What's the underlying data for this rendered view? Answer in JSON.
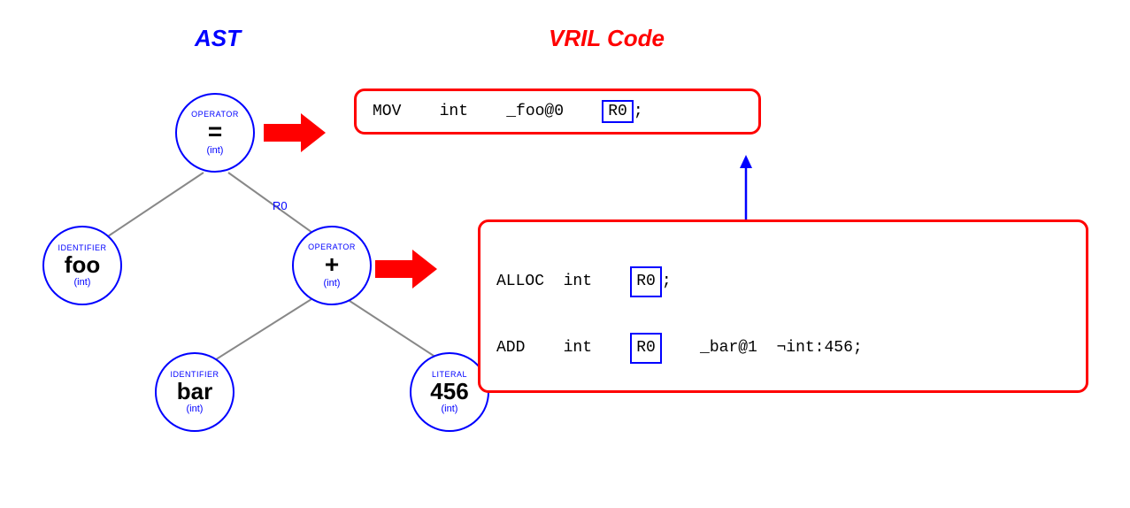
{
  "titles": {
    "ast": "AST",
    "vril": "VRIL Code"
  },
  "nodes": {
    "root": {
      "label": "OPERATOR",
      "main": "=",
      "type": "(int)"
    },
    "foo": {
      "label": "IDENTIFIER",
      "main": "foo",
      "type": "(int)"
    },
    "plus": {
      "label": "OPERATOR",
      "main": "+",
      "type": "(int)"
    },
    "bar": {
      "label": "IDENTIFIER",
      "main": "bar",
      "type": "(int)"
    },
    "lit": {
      "label": "LITERAL",
      "main": "456",
      "type": "(int)"
    }
  },
  "r0_label": "R0",
  "vril_top": {
    "prefix": "MOV    int    _foo@0    ",
    "reg": "R0",
    "suffix": ";"
  },
  "vril_bottom": {
    "line1_prefix": "ALLOC  int    ",
    "line1_reg": "R0",
    "line1_suffix": ";",
    "line2_prefix": "ADD    int    ",
    "line2_reg": "R0",
    "line2_suffix": "    _bar@1  ¬int:456;"
  }
}
